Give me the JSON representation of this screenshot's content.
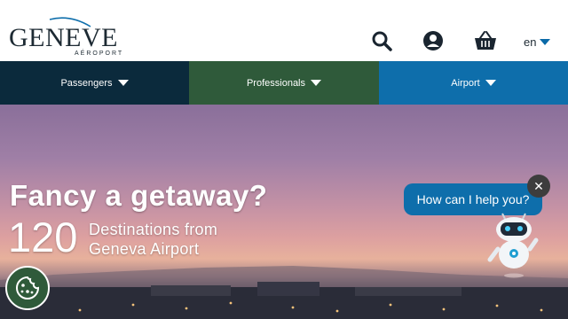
{
  "logo": {
    "word": "GENEVE",
    "sub": "AÉROPORT"
  },
  "header": {
    "icons": [
      "search-icon",
      "account-icon",
      "basket-icon"
    ],
    "language": "en"
  },
  "nav": {
    "items": [
      {
        "label": "Passengers",
        "color": "#0b2a3c"
      },
      {
        "label": "Professionals",
        "color": "#2f5a3a"
      },
      {
        "label": "Airport",
        "color": "#0e6eab"
      }
    ]
  },
  "hero": {
    "title": "Fancy a getaway?",
    "count": "120",
    "subtitle_line1": "Destinations from",
    "subtitle_line2": "Geneva Airport"
  },
  "chat": {
    "prompt": "How can I help you?",
    "close_symbol": "✕",
    "accent": "#0e6eab"
  },
  "cookie": {
    "icon": "cookie-icon"
  }
}
